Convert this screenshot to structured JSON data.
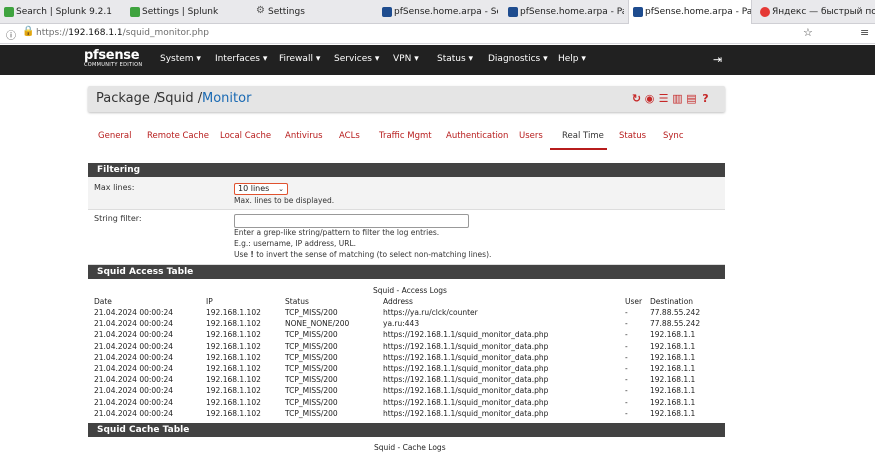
{
  "browser": {
    "tabs": [
      {
        "title": "Search | Splunk 9.2.1",
        "icon": "splunk-icon",
        "color": "#3fa33f"
      },
      {
        "title": "Settings | Splunk",
        "icon": "splunk-icon",
        "color": "#3fa33f"
      },
      {
        "title": "Settings",
        "icon": "gear-icon",
        "color": "#555555"
      },
      {
        "title": "pfSense.home.arpa - Ser",
        "icon": "pfsense-icon",
        "color": "#1e4c8f"
      },
      {
        "title": "pfSense.home.arpa - Pac",
        "icon": "pfsense-icon",
        "color": "#1e4c8f"
      },
      {
        "title": "pfSense.home.arpa - Pac",
        "icon": "pfsense-icon",
        "color": "#1e4c8f"
      },
      {
        "title": "Яндекс — быстрый пои",
        "icon": "yandex-icon",
        "color": "#e53935"
      }
    ],
    "url_prefix": "https://",
    "url_host": "192.168.1.1",
    "url_path": "/squid_monitor.php"
  },
  "navbar": {
    "logo_text": "pfsense",
    "logo_sub": "COMMUNITY EDITION",
    "items": [
      "System",
      "Interfaces",
      "Firewall",
      "Services",
      "VPN",
      "Status",
      "Diagnostics",
      "Help"
    ]
  },
  "breadcrumb": {
    "part1": "Package /",
    "part2": "Squid /",
    "part3": "Monitor"
  },
  "subtabs": [
    "General",
    "Remote Cache",
    "Local Cache",
    "Antivirus",
    "ACLs",
    "Traffic Mgmt",
    "Authentication",
    "Users",
    "Real Time",
    "Status",
    "Sync"
  ],
  "filtering": {
    "title": "Filtering",
    "max_lines_label": "Max lines:",
    "max_lines_value": "10 lines",
    "max_lines_help": "Max. lines to be displayed.",
    "string_filter_label": "String filter:",
    "string_filter_value": "",
    "help_line1": "Enter a grep-like string/pattern to filter the log entries.",
    "help_line2": "E.g.: username, IP address, URL.",
    "help_line3_pre": "Use",
    "help_line3_bang": "!",
    "help_line3_post": "to invert the sense of matching (to select non-matching lines)."
  },
  "access_table": {
    "title": "Squid Access Table",
    "caption": "Squid - Access Logs",
    "headers": [
      "Date",
      "IP",
      "Status",
      "Address",
      "User",
      "Destination"
    ],
    "rows": [
      [
        "21.04.2024 00:00:24",
        "192.168.1.102",
        "TCP_MISS/200",
        "https://ya.ru/clck/counter",
        "-",
        "77.88.55.242"
      ],
      [
        "21.04.2024 00:00:24",
        "192.168.1.102",
        "NONE_NONE/200",
        "ya.ru:443",
        "-",
        "77.88.55.242"
      ],
      [
        "21.04.2024 00:00:24",
        "192.168.1.102",
        "TCP_MISS/200",
        "https://192.168.1.1/squid_monitor_data.php",
        "-",
        "192.168.1.1"
      ],
      [
        "21.04.2024 00:00:24",
        "192.168.1.102",
        "TCP_MISS/200",
        "https://192.168.1.1/squid_monitor_data.php",
        "-",
        "192.168.1.1"
      ],
      [
        "21.04.2024 00:00:24",
        "192.168.1.102",
        "TCP_MISS/200",
        "https://192.168.1.1/squid_monitor_data.php",
        "-",
        "192.168.1.1"
      ],
      [
        "21.04.2024 00:00:24",
        "192.168.1.102",
        "TCP_MISS/200",
        "https://192.168.1.1/squid_monitor_data.php",
        "-",
        "192.168.1.1"
      ],
      [
        "21.04.2024 00:00:24",
        "192.168.1.102",
        "TCP_MISS/200",
        "https://192.168.1.1/squid_monitor_data.php",
        "-",
        "192.168.1.1"
      ],
      [
        "21.04.2024 00:00:24",
        "192.168.1.102",
        "TCP_MISS/200",
        "https://192.168.1.1/squid_monitor_data.php",
        "-",
        "192.168.1.1"
      ],
      [
        "21.04.2024 00:00:24",
        "192.168.1.102",
        "TCP_MISS/200",
        "https://192.168.1.1/squid_monitor_data.php",
        "-",
        "192.168.1.1"
      ],
      [
        "21.04.2024 00:00:24",
        "192.168.1.102",
        "TCP_MISS/200",
        "https://192.168.1.1/squid_monitor_data.php",
        "-",
        "192.168.1.1"
      ]
    ]
  },
  "cache_table": {
    "title": "Squid Cache Table",
    "caption": "Squid - Cache Logs"
  },
  "colors": {
    "navbar_bg": "#212121",
    "accent_red": "#b71c1c",
    "link_blue": "#1a6ab3",
    "section_header": "#424242"
  }
}
